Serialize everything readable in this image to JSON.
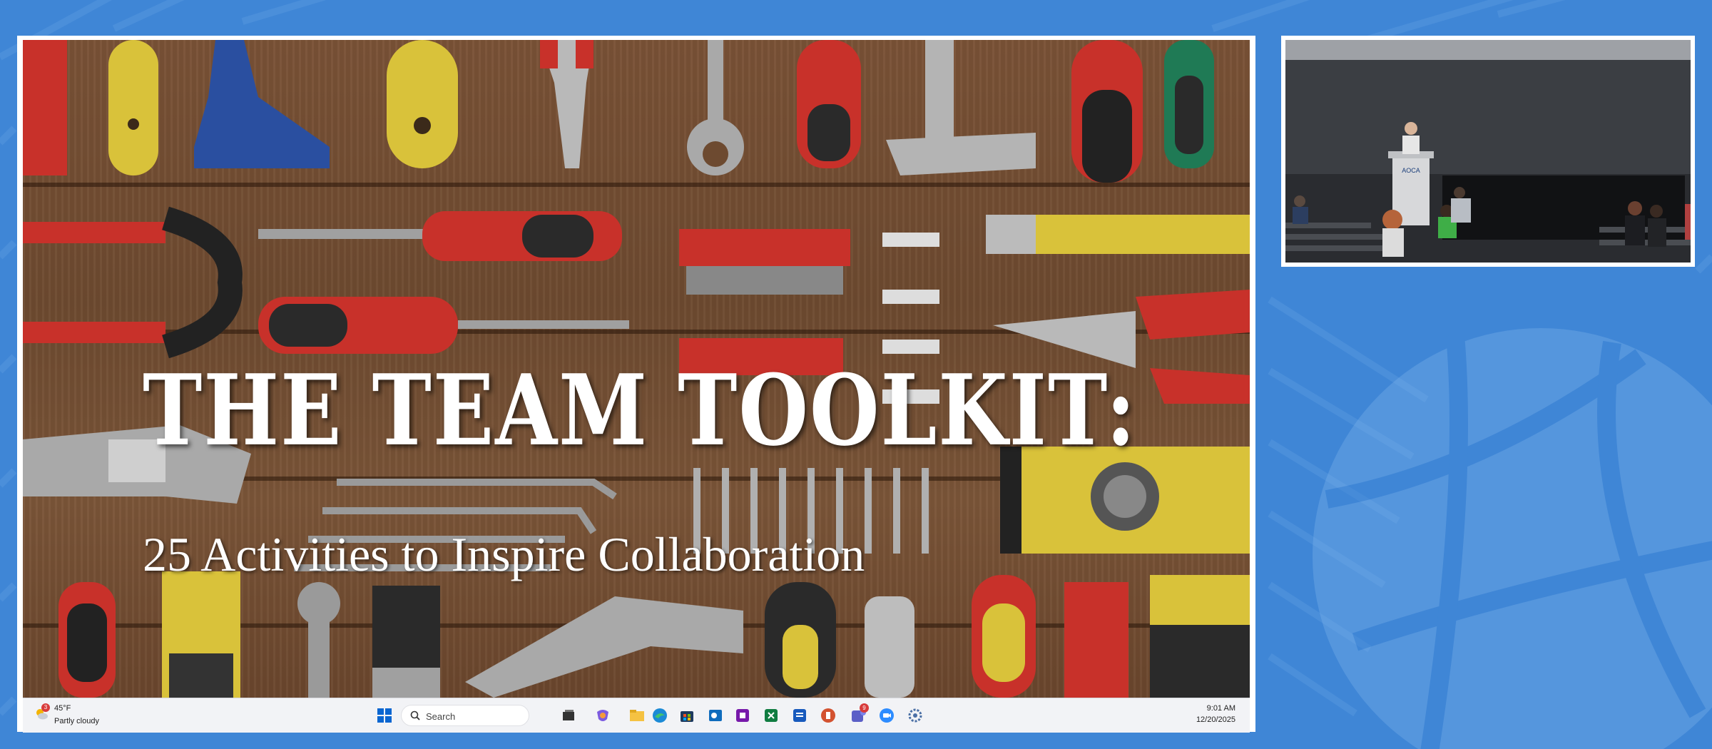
{
  "slide": {
    "title": "THE TEAM TOOLKIT:",
    "subtitle": "25 Activities to Inspire Collaboration"
  },
  "taskbar": {
    "weather": {
      "badge": "3",
      "temperature": "45°F",
      "condition": "Partly cloudy",
      "icon": "partly-cloudy-icon"
    },
    "search_placeholder": "Search",
    "apps": [
      {
        "name": "task-view-icon",
        "badge": ""
      },
      {
        "name": "copilot-icon",
        "badge": ""
      },
      {
        "name": "file-explorer-icon",
        "badge": ""
      },
      {
        "name": "edge-icon",
        "badge": ""
      },
      {
        "name": "store-icon",
        "badge": ""
      },
      {
        "name": "outlook-icon",
        "badge": ""
      },
      {
        "name": "onenote-icon",
        "badge": ""
      },
      {
        "name": "excel-icon",
        "badge": ""
      },
      {
        "name": "word-icon",
        "badge": ""
      },
      {
        "name": "powerpoint-icon",
        "badge": ""
      },
      {
        "name": "teams-icon",
        "badge": "9"
      },
      {
        "name": "zoom-icon",
        "badge": ""
      },
      {
        "name": "settings-icon",
        "badge": ""
      }
    ],
    "clock": {
      "time": "9:01 AM",
      "date": "12/20/2025"
    }
  },
  "camera": {
    "podium_sign": "AOCA"
  },
  "colors": {
    "background": "#3f86d6",
    "wood": "#6d4a30",
    "tool_red": "#c8312a",
    "tool_yellow": "#d9c23a",
    "taskbar": "#f2f3f6"
  }
}
